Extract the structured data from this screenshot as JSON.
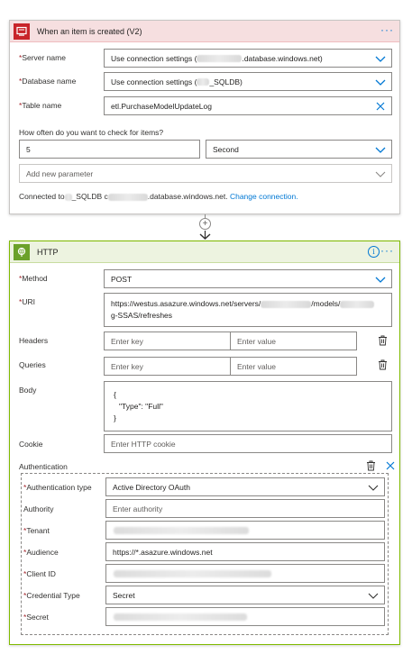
{
  "trigger": {
    "title": "When an item is created (V2)",
    "more": "···",
    "fields": {
      "server_name": {
        "label": "Server name",
        "value_prefix": "Use connection settings (",
        "value_suffix": ".database.windows.net)"
      },
      "database_name": {
        "label": "Database name",
        "value_prefix": "Use connection settings (",
        "value_suffix": "_SQLDB)"
      },
      "table_name": {
        "label": "Table name",
        "value": "etl.PurchaseModelUpdateLog"
      }
    },
    "frequency_label": "How often do you want to check for items?",
    "interval_value": "5",
    "unit_value": "Second",
    "add_param_placeholder": "Add new parameter",
    "connected_prefix": "Connected to",
    "connected_mid": "_SQLDB c",
    "connected_suffix": ".database.windows.net.",
    "change_connection": "Change connection."
  },
  "connector": {
    "plus": "+"
  },
  "http": {
    "title": "HTTP",
    "info": "i",
    "more": "···",
    "method": {
      "label": "Method",
      "value": "POST"
    },
    "uri": {
      "label": "URI",
      "line1_prefix": "https://westus.asazure.windows.net/servers/",
      "line1_mid": "/models/",
      "line2": "g-SSAS/refreshes"
    },
    "headers": {
      "label": "Headers",
      "key_placeholder": "Enter key",
      "value_placeholder": "Enter value"
    },
    "queries": {
      "label": "Queries",
      "key_placeholder": "Enter key",
      "value_placeholder": "Enter value"
    },
    "body": {
      "label": "Body",
      "line1": "{",
      "line2": "\"Type\": \"Full\"",
      "line3": "}"
    },
    "cookie": {
      "label": "Cookie",
      "placeholder": "Enter HTTP cookie"
    },
    "authentication": {
      "label": "Authentication",
      "type": {
        "label": "Authentication type",
        "value": "Active Directory OAuth"
      },
      "authority": {
        "label": "Authority",
        "placeholder": "Enter authority"
      },
      "tenant": {
        "label": "Tenant"
      },
      "audience": {
        "label": "Audience",
        "value": "https://*.asazure.windows.net"
      },
      "client_id": {
        "label": "Client ID"
      },
      "credential_type": {
        "label": "Credential Type",
        "value": "Secret"
      },
      "secret": {
        "label": "Secret"
      }
    }
  },
  "required_mark": "*"
}
